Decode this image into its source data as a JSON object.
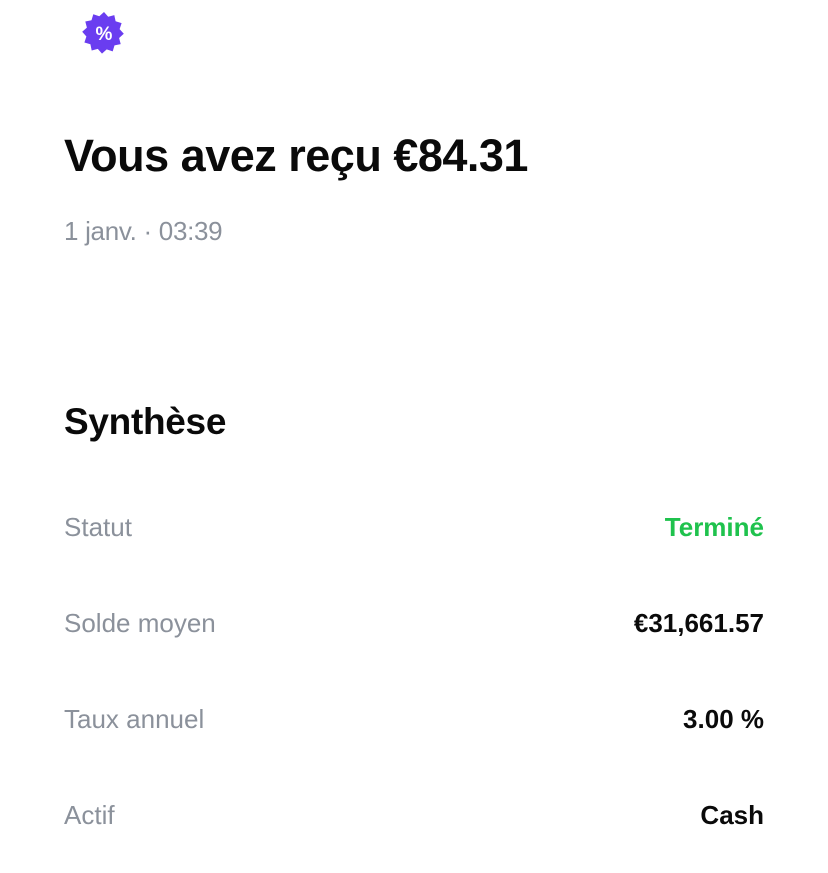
{
  "colors": {
    "accent": "#6a3df0",
    "status_done": "#1fc24d",
    "muted_text": "#8b919b",
    "primary_text": "#0a0a0a"
  },
  "header": {
    "icon": "percent-badge-icon",
    "icon_glyph": "%",
    "title": "Vous avez reçu €84.31",
    "timestamp": "1 janv. · 03:39"
  },
  "summary": {
    "title": "Synthèse",
    "rows": [
      {
        "label": "Statut",
        "value": "Terminé"
      },
      {
        "label": "Solde moyen",
        "value": "€31,661.57"
      },
      {
        "label": "Taux annuel",
        "value": "3.00 %"
      },
      {
        "label": "Actif",
        "value": "Cash"
      }
    ]
  }
}
